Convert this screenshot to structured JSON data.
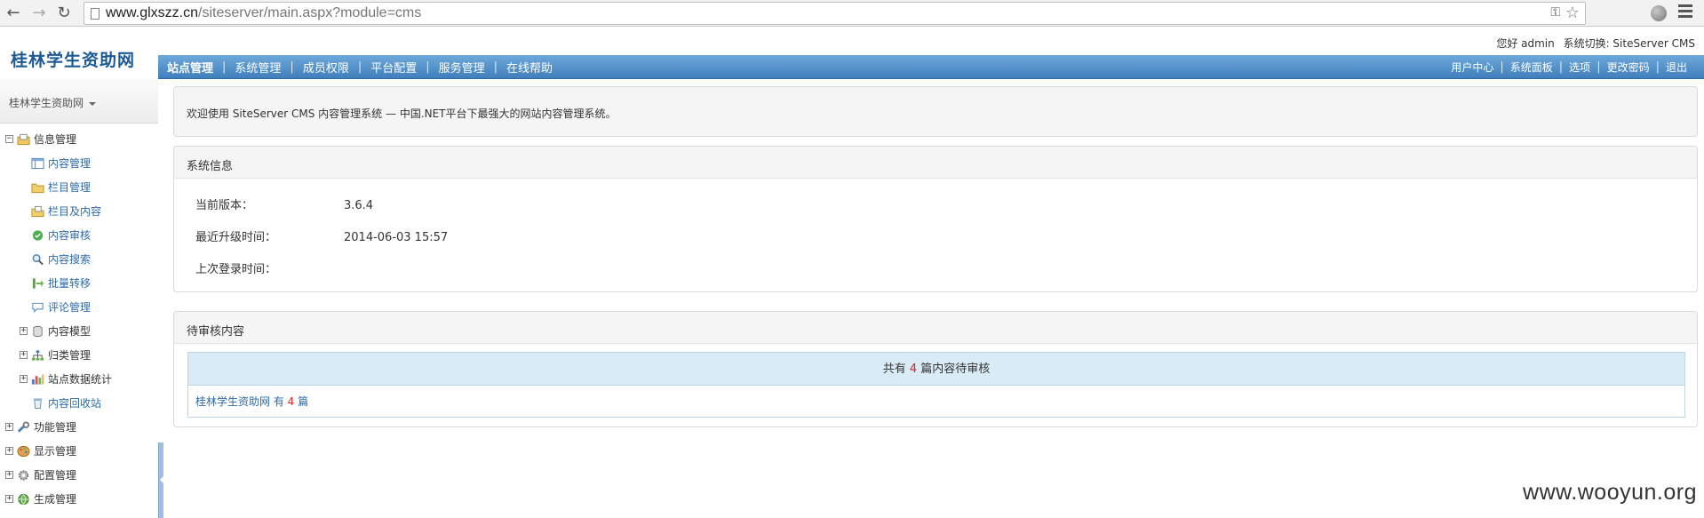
{
  "browser": {
    "url_host": "www.glxszz.cn",
    "url_path": "/siteserver/main.aspx?module=cms",
    "back_icon": "arrow-left-icon",
    "forward_icon": "arrow-right-icon",
    "reload_icon": "reload-icon"
  },
  "header": {
    "logo": "桂林学生资助网",
    "greeting": "您好 admin",
    "system_switch": "系统切换: SiteServer CMS"
  },
  "topnav": {
    "left": [
      "站点管理",
      "系统管理",
      "成员权限",
      "平台配置",
      "服务管理",
      "在线帮助"
    ],
    "right": [
      "用户中心",
      "系统面板",
      "选项",
      "更改密码",
      "退出"
    ],
    "sep": "|"
  },
  "sidebar": {
    "site_name": "桂林学生资助网",
    "items": [
      {
        "label": "信息管理",
        "toggle": "⊟",
        "icon": "folder-pages-icon"
      },
      {
        "label": "内容管理",
        "icon": "content-table-icon"
      },
      {
        "label": "栏目管理",
        "icon": "folder-icon"
      },
      {
        "label": "栏目及内容",
        "icon": "folder-content-icon"
      },
      {
        "label": "内容审核",
        "icon": "check-circle-icon"
      },
      {
        "label": "内容搜索",
        "icon": "magnifier-icon"
      },
      {
        "label": "批量转移",
        "icon": "transfer-icon"
      },
      {
        "label": "评论管理",
        "icon": "comment-icon"
      },
      {
        "label": "内容模型",
        "toggle": "⊞",
        "icon": "database-icon"
      },
      {
        "label": "归类管理",
        "toggle": "⊞",
        "icon": "sitemap-icon"
      },
      {
        "label": "站点数据统计",
        "toggle": "⊞",
        "icon": "bar-chart-icon"
      },
      {
        "label": "内容回收站",
        "icon": "recycle-bin-icon"
      },
      {
        "label": "功能管理",
        "toggle": "⊞",
        "icon": "wrench-icon"
      },
      {
        "label": "显示管理",
        "toggle": "⊞",
        "icon": "palette-icon"
      },
      {
        "label": "配置管理",
        "toggle": "⊞",
        "icon": "gear-icon"
      },
      {
        "label": "生成管理",
        "toggle": "⊞",
        "icon": "globe-icon"
      }
    ]
  },
  "welcome": {
    "text": "欢迎使用 SiteServer CMS 内容管理系统 — 中国.NET平台下最强大的网站内容管理系统。"
  },
  "system_info": {
    "title": "系统信息",
    "rows": [
      {
        "key": "当前版本：",
        "value": "3.6.4"
      },
      {
        "key": "最近升级时间：",
        "value": "2014-06-03 15:57"
      },
      {
        "key": "上次登录时间：",
        "value": ""
      }
    ]
  },
  "pending": {
    "title": "待审核内容",
    "summary_prefix": "共有",
    "count": "4",
    "summary_suffix": "篇内容待审核",
    "site_link_prefix": "桂林学生资助网 有",
    "site_count": "4",
    "site_link_suffix": "篇"
  },
  "watermark": "www.wooyun.org"
}
